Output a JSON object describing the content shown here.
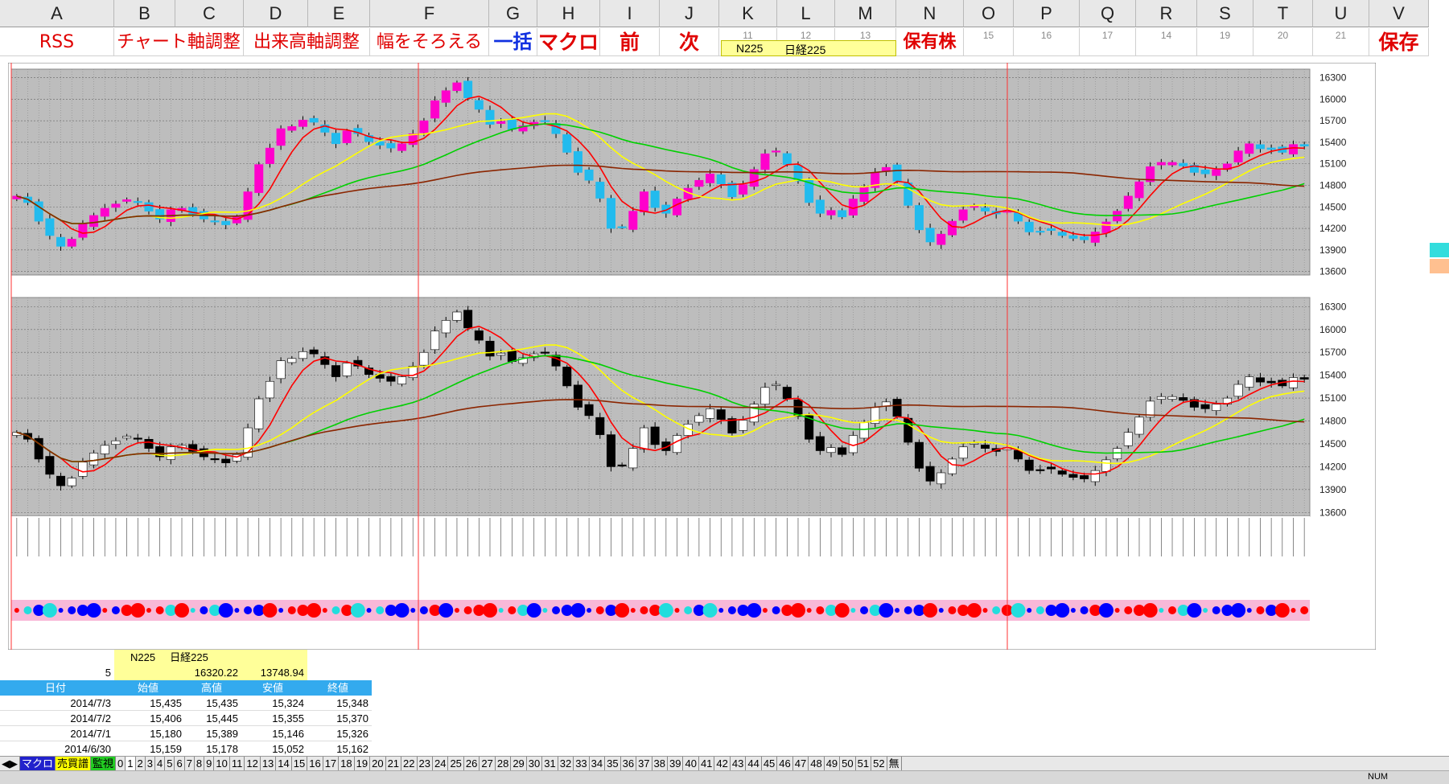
{
  "columns": [
    "A",
    "B",
    "C",
    "D",
    "E",
    "F",
    "G",
    "H",
    "I",
    "J",
    "K",
    "L",
    "M",
    "N",
    "O",
    "P",
    "Q",
    "R",
    "S",
    "T",
    "U",
    "V"
  ],
  "row2": {
    "rss": "RSS",
    "chart_axis": "チャート軸調整",
    "volume_axis": "出来高軸調整",
    "align_width": "幅をそろえる",
    "batch": "一括",
    "macro": "マクロ",
    "prev": "前",
    "next": "次",
    "holdings": "保有株",
    "save": "保存",
    "k_num": "11",
    "l_num": "12",
    "m_num": "13",
    "o_num": "15",
    "p_num": "16",
    "q_num": "17",
    "r_num": "14",
    "s_num": "19",
    "t_num": "20",
    "u_num": "21",
    "selected_code": "N225",
    "selected_name": "日経225"
  },
  "chart_data": {
    "type": "candlestick",
    "title": "",
    "y_ticks": [
      13600,
      13900,
      14200,
      14500,
      14800,
      15100,
      15400,
      15700,
      16000,
      16300
    ],
    "ylim": [
      13550,
      16420
    ],
    "legend": "none",
    "grid": true,
    "series": [
      {
        "name": "close",
        "values": [
          14650,
          14560,
          14300,
          14100,
          13950,
          14050,
          14260,
          14380,
          14480,
          14540,
          14600,
          14560,
          14440,
          14330,
          14460,
          14480,
          14400,
          14330,
          14300,
          14250,
          14360,
          14710,
          15090,
          15320,
          15590,
          15620,
          15710,
          15680,
          15540,
          15380,
          15560,
          15520,
          15410,
          15360,
          15320,
          15380,
          15520,
          15700,
          15980,
          16120,
          16230,
          16020,
          15860,
          15650,
          15690,
          15580,
          15630,
          15680,
          15700,
          15520,
          15260,
          14980,
          14870,
          14620,
          14200,
          14220,
          14440,
          14710,
          14490,
          14410,
          14610,
          14760,
          14870,
          14960,
          14820,
          14640,
          14810,
          15020,
          15240,
          15280,
          15090,
          14860,
          14560,
          14410,
          14450,
          14360,
          14610,
          14780,
          14980,
          15050,
          14860,
          14520,
          14180,
          14010,
          14120,
          14300,
          14460,
          14510,
          14440,
          14400,
          14450,
          14300,
          14150,
          14160,
          14170,
          14100,
          14060,
          14040,
          14150,
          14290,
          14440,
          14650,
          14850,
          15060,
          15120,
          15120,
          15070,
          14980,
          14960,
          15020,
          15100,
          15280,
          15380,
          15310,
          15300,
          15260,
          15370,
          15348
        ]
      }
    ],
    "moving_averages": [
      {
        "color": "#ff0000"
      },
      {
        "color": "#ffff00"
      },
      {
        "color": "#00d000"
      },
      {
        "color": "#8b2500"
      }
    ]
  },
  "table": {
    "code": "N225",
    "name": "日経225",
    "count": "5",
    "high": "16320.22",
    "low": "13748.94",
    "header": [
      "日付",
      "始値",
      "高値",
      "安値",
      "終値"
    ],
    "rows": [
      [
        "2014/7/3",
        "15,435",
        "15,435",
        "15,324",
        "15,348"
      ],
      [
        "2014/7/2",
        "15,406",
        "15,445",
        "15,355",
        "15,370"
      ],
      [
        "2014/7/1",
        "15,180",
        "15,389",
        "15,146",
        "15,326"
      ],
      [
        "2014/6/30",
        "15,159",
        "15,178",
        "15,052",
        "15,162"
      ]
    ]
  },
  "sheet_tabs": [
    "マクロ",
    "売買譜",
    "監視",
    "0",
    "1",
    "2",
    "3",
    "4",
    "5",
    "6",
    "7",
    "8",
    "9",
    "10",
    "11",
    "12",
    "13",
    "14",
    "15",
    "16",
    "17",
    "18",
    "19",
    "20",
    "21",
    "22",
    "23",
    "24",
    "25",
    "26",
    "27",
    "28",
    "29",
    "30",
    "31",
    "32",
    "33",
    "34",
    "35",
    "36",
    "37",
    "38",
    "39",
    "40",
    "41",
    "42",
    "43",
    "44",
    "45",
    "46",
    "47",
    "48",
    "49",
    "50",
    "51",
    "52",
    "無"
  ],
  "status": {
    "mode": "NUM"
  }
}
